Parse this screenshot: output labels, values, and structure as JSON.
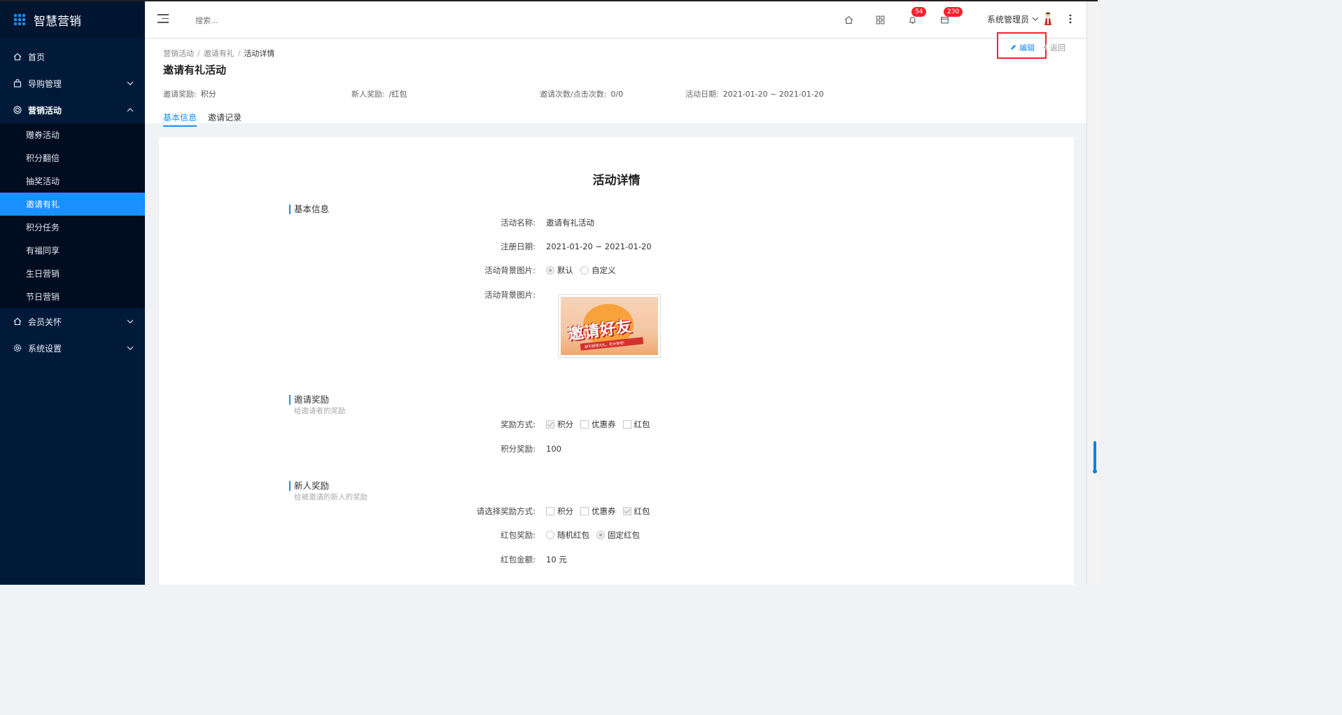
{
  "app": {
    "name": "智慧营销"
  },
  "sidebar": {
    "items": [
      {
        "label": "首页",
        "icon": "home-icon",
        "has_children": false
      },
      {
        "label": "导购管理",
        "icon": "bag-icon",
        "has_children": true
      },
      {
        "label": "营销活动",
        "icon": "target-icon",
        "has_children": true,
        "open": true
      }
    ],
    "sub_items": [
      {
        "label": "赠券活动"
      },
      {
        "label": "积分翻倍"
      },
      {
        "label": "抽奖活动"
      },
      {
        "label": "邀请有礼",
        "active": true
      },
      {
        "label": "积分任务"
      },
      {
        "label": "有福同享"
      },
      {
        "label": "生日营销"
      },
      {
        "label": "节日营销"
      }
    ],
    "bottom_items": [
      {
        "label": "会员关怀",
        "icon": "home-heart-icon"
      },
      {
        "label": "系统设置",
        "icon": "gear-icon"
      }
    ]
  },
  "header": {
    "search_placeholder": "搜索...",
    "notification_count": "54",
    "message_count": "230",
    "user_name": "系统管理员"
  },
  "page": {
    "breadcrumb": [
      "营销活动",
      "邀请有礼",
      "活动详情"
    ],
    "title": "邀请有礼活动",
    "summary": [
      {
        "label": "邀请奖励:",
        "value": "积分"
      },
      {
        "label": "新人奖励:",
        "value": "/红包"
      },
      {
        "label": "邀请次数/点击次数:",
        "value": "0/0"
      },
      {
        "label": "活动日期:",
        "value": "2021-01-20 ~ 2021-01-20"
      }
    ],
    "tabs": [
      "基本信息",
      "邀请记录"
    ],
    "edit_label": "编辑",
    "back_label": "返回"
  },
  "detail": {
    "title": "活动详情",
    "basic": {
      "section_title": "基本信息",
      "name_label": "活动名称:",
      "name_value": "邀请有礼活动",
      "date_label": "注册日期:",
      "date_value": "2021-01-20 ~ 2021-01-20",
      "bg_label": "活动背景图片:",
      "bg_options": [
        "默认",
        "自定义"
      ],
      "bg_selected": "默认",
      "bg_image_label": "活动背景图片:",
      "bg_image_text": "邀请好友",
      "bg_image_ribbon": "即可获得大礼，无分享吧!"
    },
    "invite": {
      "section_title": "邀请奖励",
      "section_sub": "给邀请者的奖励",
      "method_label": "奖励方式:",
      "methods": [
        "积分",
        "优惠券",
        "红包"
      ],
      "methods_checked": [
        "积分"
      ],
      "points_label": "积分奖励:",
      "points_value": "100"
    },
    "newbie": {
      "section_title": "新人奖励",
      "section_sub": "给被邀请的新人的奖励",
      "method_label": "请选择奖励方式:",
      "methods": [
        "积分",
        "优惠券",
        "红包"
      ],
      "methods_checked": [
        "红包"
      ],
      "redpack_label": "红包奖励:",
      "redpack_options": [
        "随机红包",
        "固定红包"
      ],
      "redpack_selected": "固定红包",
      "amount_label": "红包金额:",
      "amount_value": "10 元"
    }
  },
  "colors": {
    "primary": "#1890ff",
    "sidebar_bg": "#011a3a",
    "highlight_border": "#f5222d"
  }
}
